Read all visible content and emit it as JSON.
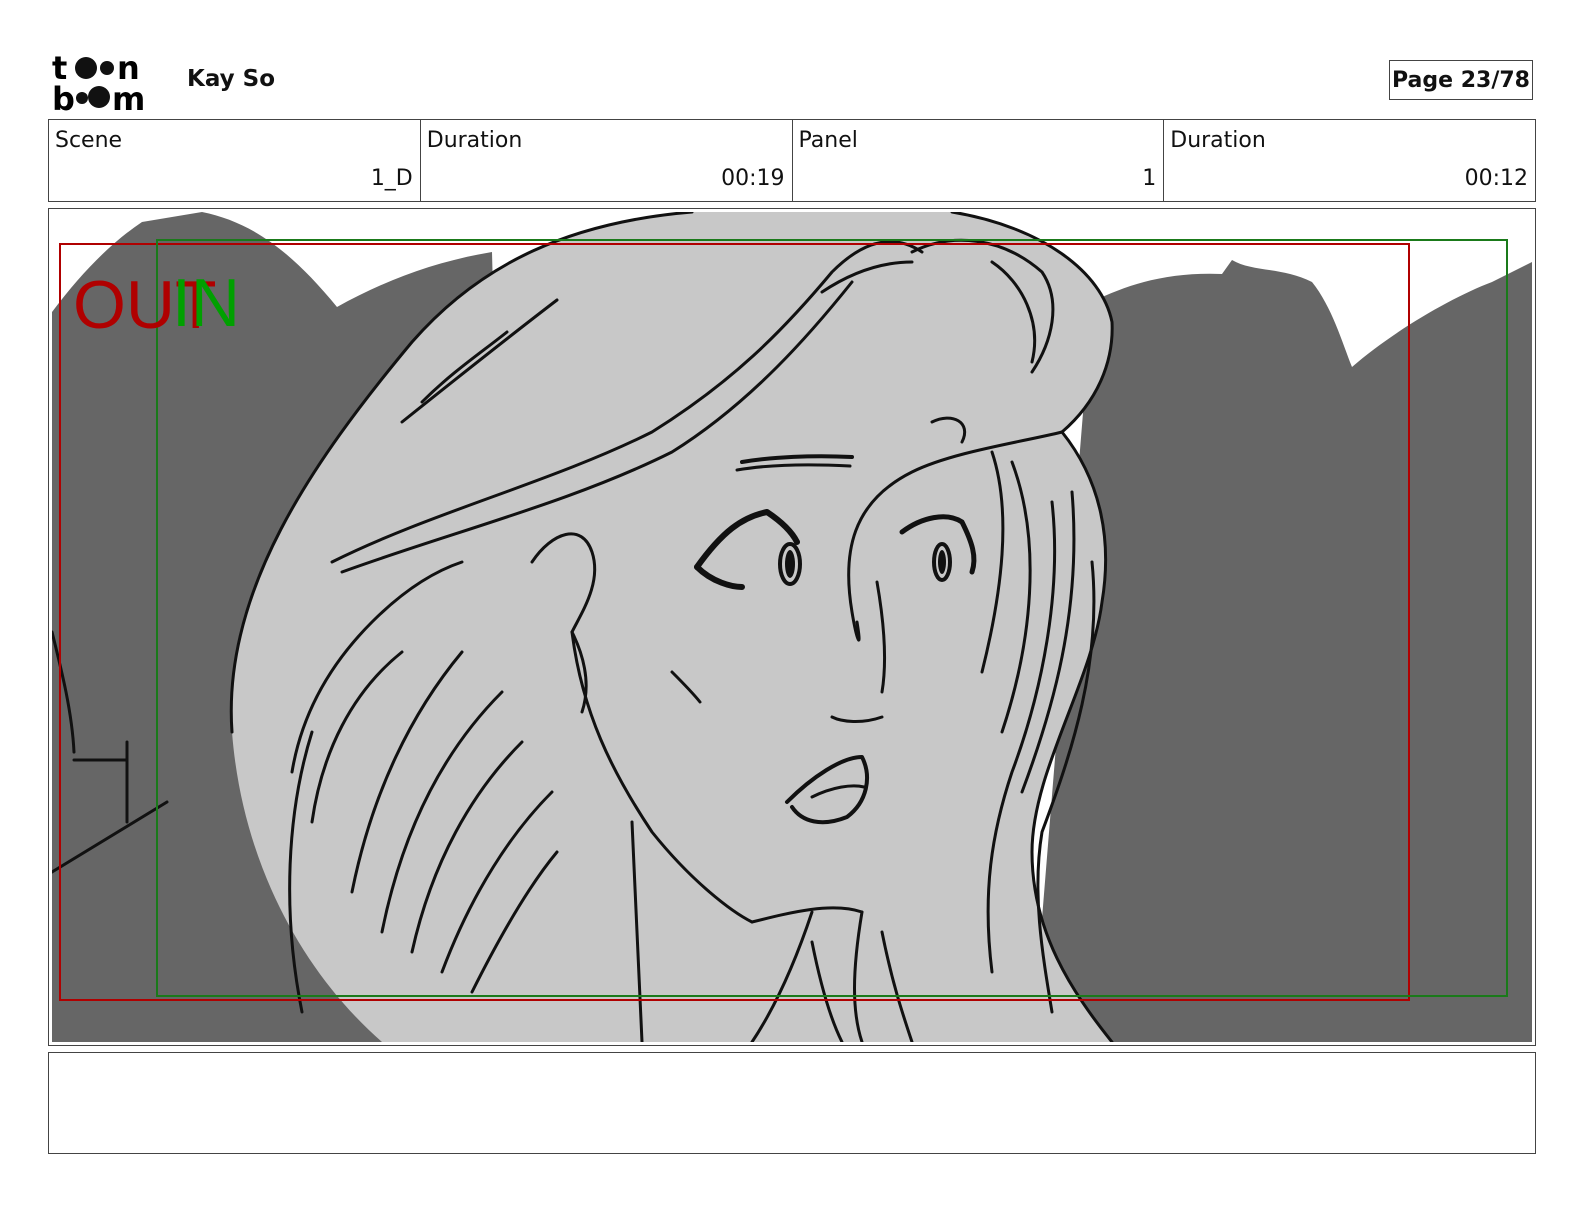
{
  "header": {
    "logo_top": "toon",
    "logo_bottom": "boom",
    "author": "Kay So",
    "page": "Page 23/78"
  },
  "info": {
    "scene_label": "Scene",
    "scene_value": "1_D",
    "scene_duration_label": "Duration",
    "scene_duration_value": "00:19",
    "panel_label": "Panel",
    "panel_value": "1",
    "panel_duration_label": "Duration",
    "panel_duration_value": "00:12"
  },
  "panel": {
    "out_label": "OUT",
    "in_label": "IN"
  },
  "colors": {
    "out_frame": "#b00000",
    "in_frame": "#1a7a1a",
    "background_shape": "#666666",
    "figure_fill": "#c8c8c8"
  },
  "notes": ""
}
